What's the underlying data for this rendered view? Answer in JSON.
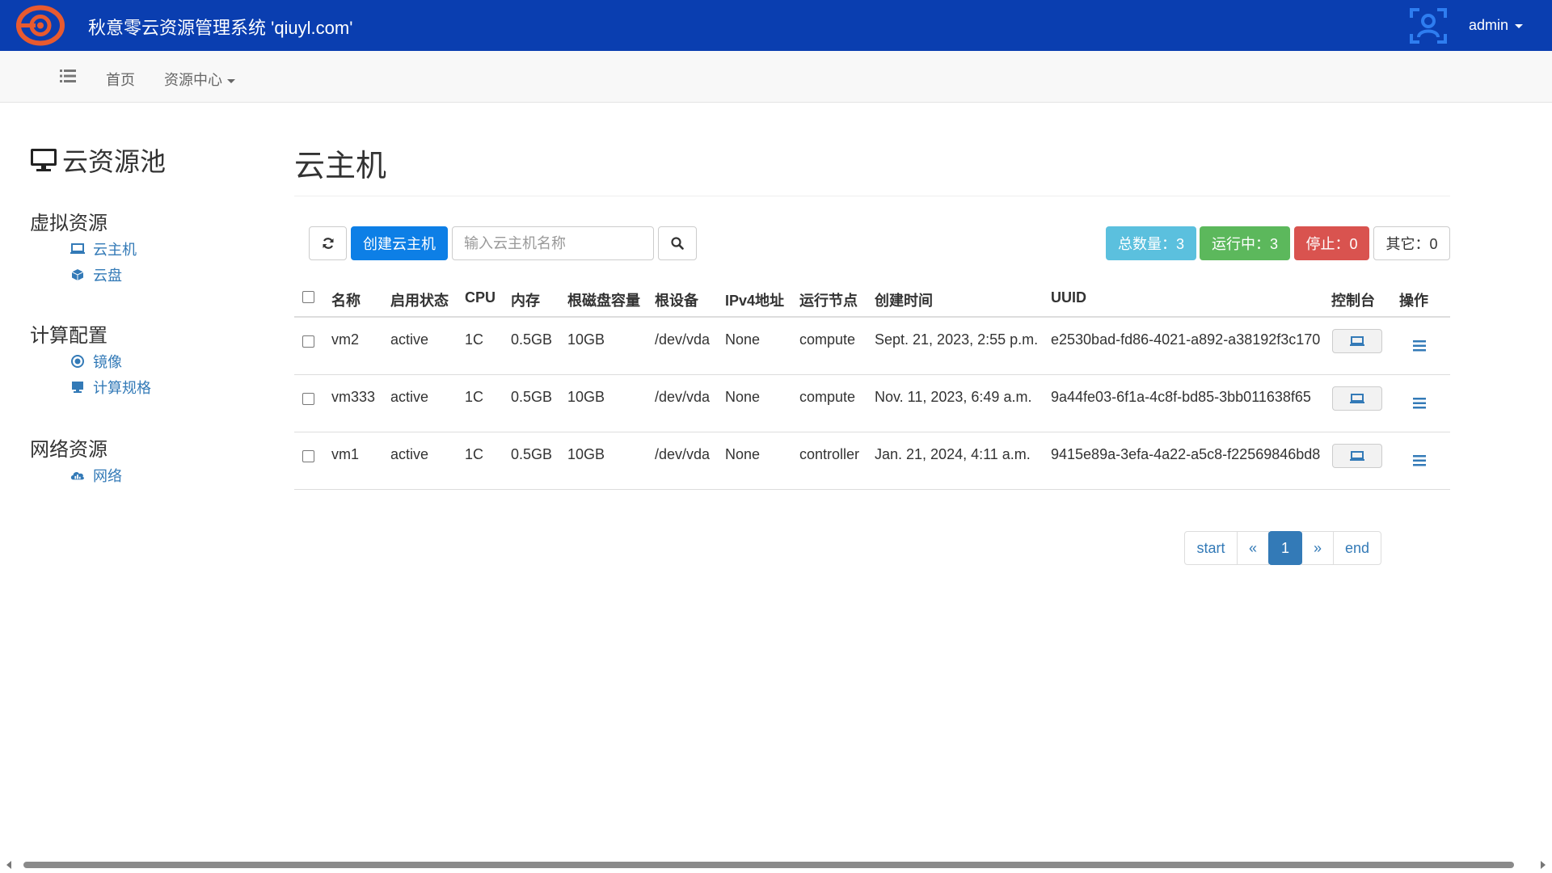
{
  "app": {
    "title": "秋意零云资源管理系统 'qiuyl.com'",
    "user": "admin",
    "brand_color": "#0a3eb0"
  },
  "subnav": {
    "home": "首页",
    "resource_center": "资源中心"
  },
  "sidebar": {
    "title": "云资源池",
    "sections": [
      {
        "label": "虚拟资源",
        "items": [
          {
            "label": "云主机",
            "icon": "laptop-icon"
          },
          {
            "label": "云盘",
            "icon": "cube-icon"
          }
        ]
      },
      {
        "label": "计算配置",
        "items": [
          {
            "label": "镜像",
            "icon": "record-icon"
          },
          {
            "label": "计算规格",
            "icon": "monitor-icon"
          }
        ]
      },
      {
        "label": "网络资源",
        "items": [
          {
            "label": "网络",
            "icon": "cloud-icon"
          }
        ]
      }
    ]
  },
  "main": {
    "title": "云主机",
    "create_label": "创建云主机",
    "search_placeholder": "输入云主机名称",
    "stats": {
      "total": "总数量：3",
      "running": "运行中：3",
      "stopped": "停止：0",
      "other": "其它：0"
    },
    "columns": [
      "名称",
      "启用状态",
      "CPU",
      "内存",
      "根磁盘容量",
      "根设备",
      "IPv4地址",
      "运行节点",
      "创建时间",
      "UUID",
      "控制台",
      "操作"
    ],
    "rows": [
      [
        "vm2",
        "active",
        "1C",
        "0.5GB",
        "10GB",
        "/dev/vda",
        "None",
        "compute",
        "Sept. 21, 2023, 2:55 p.m.",
        "e2530bad-fd86-4021-a892-a38192f3c170"
      ],
      [
        "vm333",
        "active",
        "1C",
        "0.5GB",
        "10GB",
        "/dev/vda",
        "None",
        "compute",
        "Nov. 11, 2023, 6:49 a.m.",
        "9a44fe03-6f1a-4c8f-bd85-3bb011638f65"
      ],
      [
        "vm1",
        "active",
        "1C",
        "0.5GB",
        "10GB",
        "/dev/vda",
        "None",
        "controller",
        "Jan. 21, 2024, 4:11 a.m.",
        "9415e89a-3efa-4a22-a5c8-f22569846bd8"
      ]
    ]
  },
  "pagination": {
    "start": "start",
    "prev": "«",
    "current": "1",
    "next": "»",
    "end": "end"
  }
}
